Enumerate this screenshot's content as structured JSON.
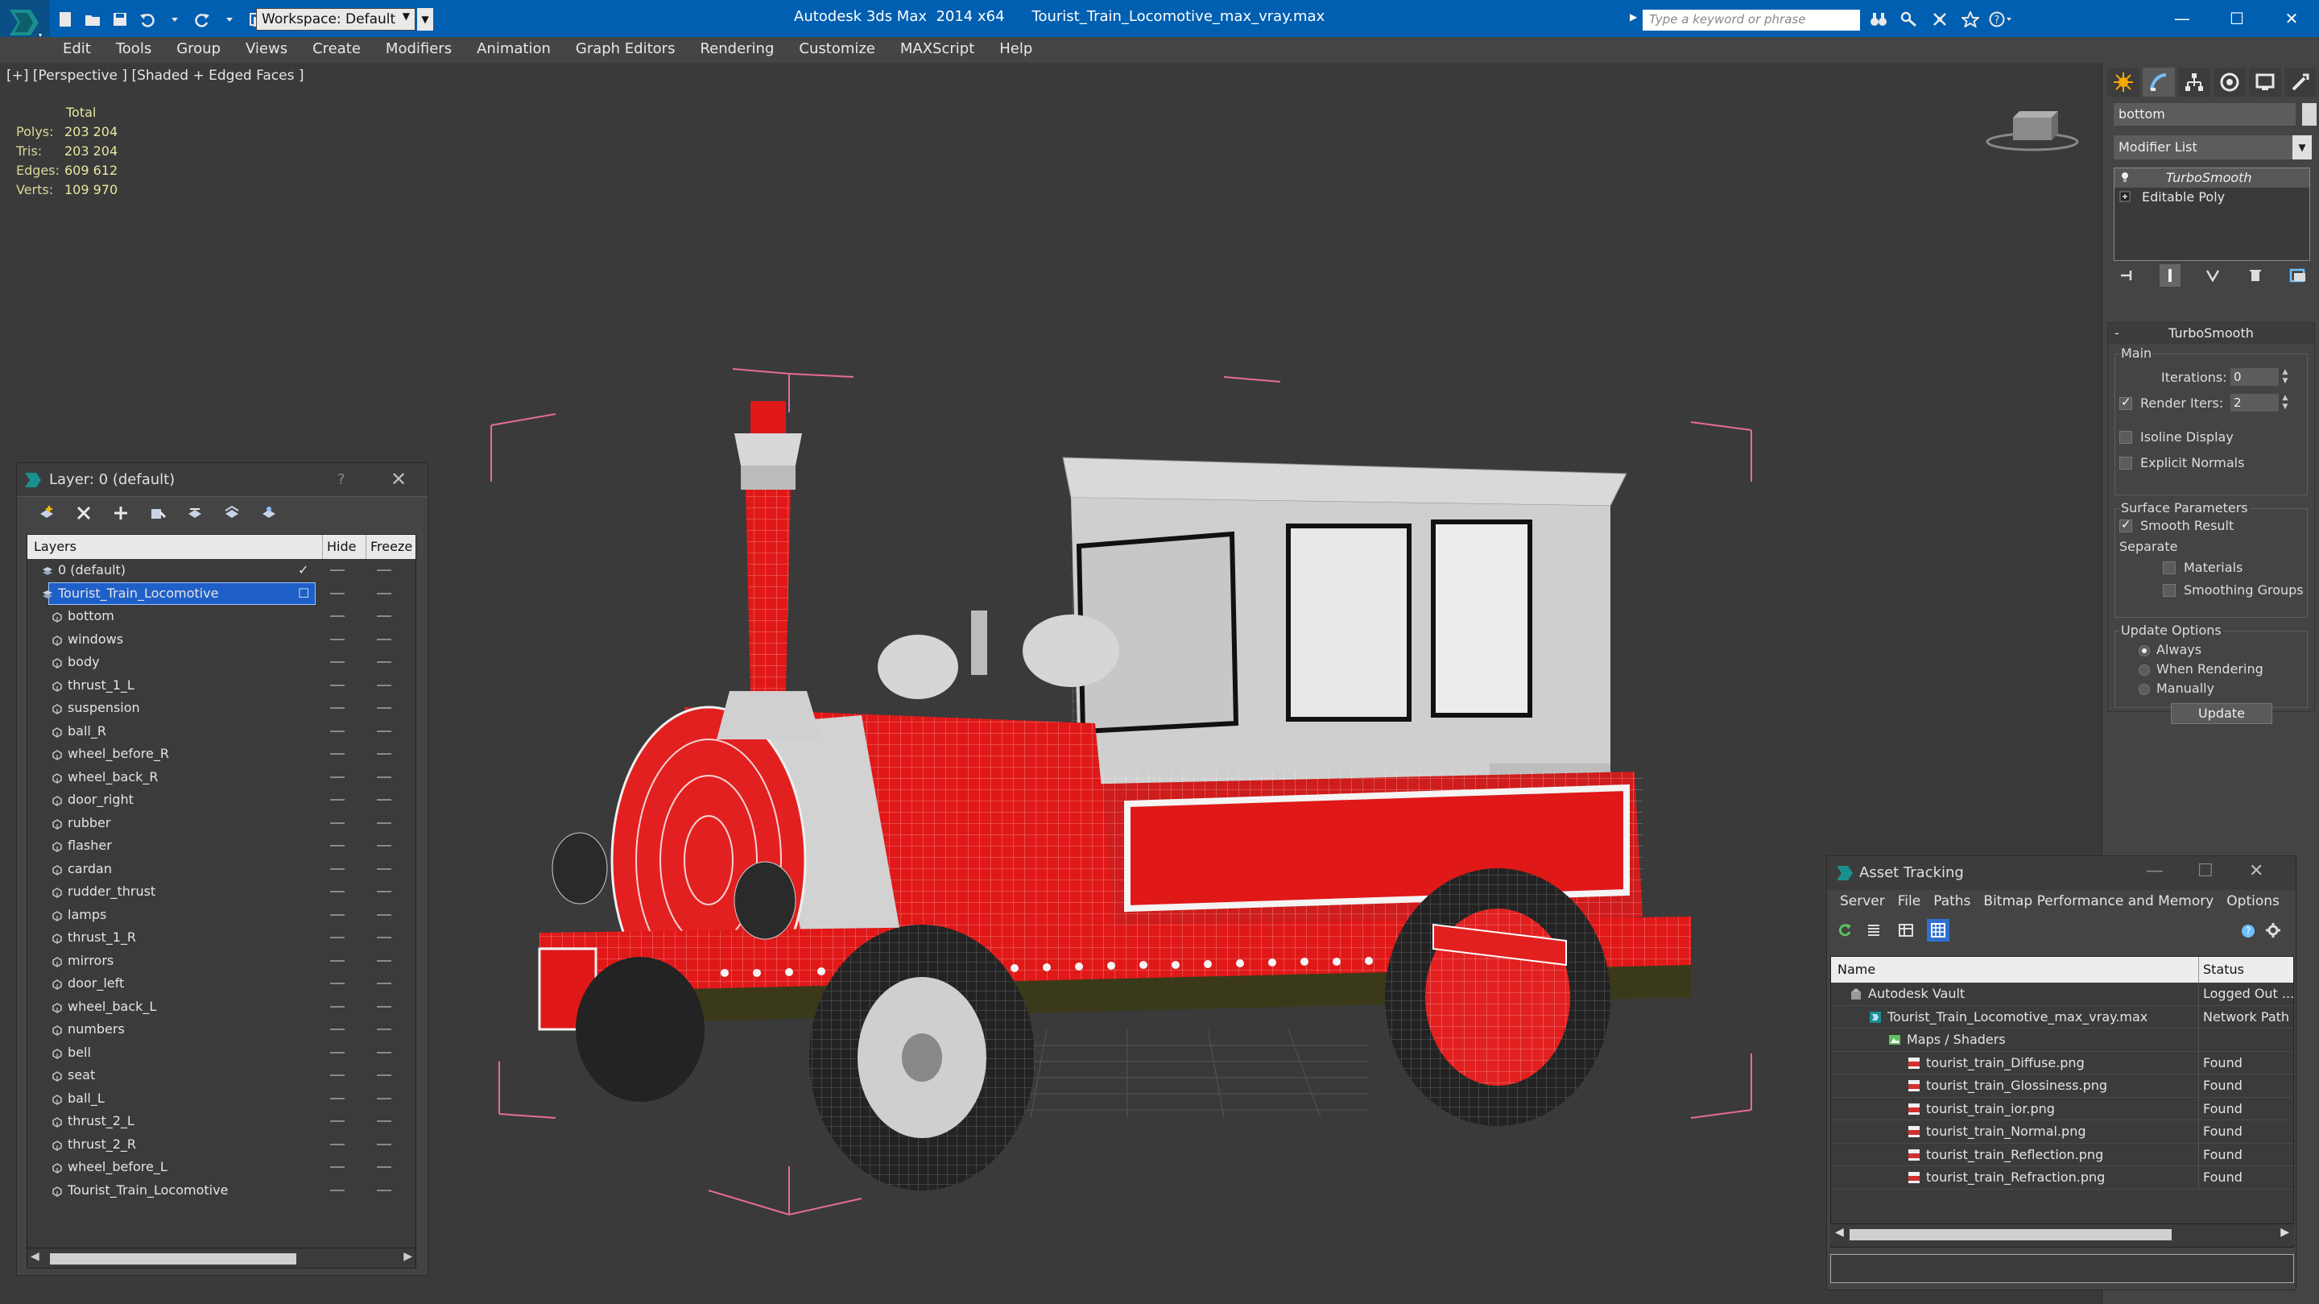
{
  "titlebar": {
    "workspace": "Workspace: Default",
    "app_name": "Autodesk 3ds Max  2014 x64",
    "file_name": "Tourist_Train_Locomotive_max_vray.max",
    "search_placeholder": "Type a keyword or phrase"
  },
  "menu": [
    "Edit",
    "Tools",
    "Group",
    "Views",
    "Create",
    "Modifiers",
    "Animation",
    "Graph Editors",
    "Rendering",
    "Customize",
    "MAXScript",
    "Help"
  ],
  "viewport": {
    "label": "[+] [Perspective ] [Shaded + Edged Faces ]",
    "stats": {
      "header": "Total",
      "rows": [
        {
          "label": "Polys:",
          "value": "203 204"
        },
        {
          "label": "Tris:",
          "value": "203 204"
        },
        {
          "label": "Edges:",
          "value": "609 612"
        },
        {
          "label": "Verts:",
          "value": "109 970"
        }
      ]
    }
  },
  "layer_panel": {
    "title": "Layer: 0 (default)",
    "help": "?",
    "columns": {
      "layers": "Layers",
      "hide": "Hide",
      "freeze": "Freeze"
    },
    "layers": [
      {
        "name": "0 (default)",
        "level": 0,
        "kind": "layer",
        "current": true
      },
      {
        "name": "Tourist_Train_Locomotive",
        "level": 0,
        "kind": "layer",
        "selected": true
      },
      {
        "name": "bottom",
        "level": 1,
        "kind": "object"
      },
      {
        "name": "windows",
        "level": 1,
        "kind": "object"
      },
      {
        "name": "body",
        "level": 1,
        "kind": "object"
      },
      {
        "name": "thrust_1_L",
        "level": 1,
        "kind": "object"
      },
      {
        "name": "suspension",
        "level": 1,
        "kind": "object"
      },
      {
        "name": "ball_R",
        "level": 1,
        "kind": "object"
      },
      {
        "name": "wheel_before_R",
        "level": 1,
        "kind": "object"
      },
      {
        "name": "wheel_back_R",
        "level": 1,
        "kind": "object"
      },
      {
        "name": "door_right",
        "level": 1,
        "kind": "object"
      },
      {
        "name": "rubber",
        "level": 1,
        "kind": "object"
      },
      {
        "name": "flasher",
        "level": 1,
        "kind": "object"
      },
      {
        "name": "cardan",
        "level": 1,
        "kind": "object"
      },
      {
        "name": "rudder_thrust",
        "level": 1,
        "kind": "object"
      },
      {
        "name": "lamps",
        "level": 1,
        "kind": "object"
      },
      {
        "name": "thrust_1_R",
        "level": 1,
        "kind": "object"
      },
      {
        "name": "mirrors",
        "level": 1,
        "kind": "object"
      },
      {
        "name": "door_left",
        "level": 1,
        "kind": "object"
      },
      {
        "name": "wheel_back_L",
        "level": 1,
        "kind": "object"
      },
      {
        "name": "numbers",
        "level": 1,
        "kind": "object"
      },
      {
        "name": "bell",
        "level": 1,
        "kind": "object"
      },
      {
        "name": "seat",
        "level": 1,
        "kind": "object"
      },
      {
        "name": "ball_L",
        "level": 1,
        "kind": "object"
      },
      {
        "name": "thrust_2_L",
        "level": 1,
        "kind": "object"
      },
      {
        "name": "thrust_2_R",
        "level": 1,
        "kind": "object"
      },
      {
        "name": "wheel_before_L",
        "level": 1,
        "kind": "object"
      },
      {
        "name": "Tourist_Train_Locomotive",
        "level": 1,
        "kind": "object"
      }
    ]
  },
  "command_panel": {
    "object_name": "bottom",
    "modifier_list": "Modifier List",
    "stack": [
      {
        "name": "TurboSmooth",
        "selected": true
      },
      {
        "name": "Editable Poly",
        "selected": false
      }
    ],
    "turbosmooth": {
      "title": "TurboSmooth",
      "main_label": "Main",
      "iterations_label": "Iterations:",
      "iterations": "0",
      "render_iters_label": "Render Iters:",
      "render_iters": "2",
      "render_iters_checked": true,
      "isoline_display": "Isoline Display",
      "isoline_checked": false,
      "explicit_normals": "Explicit Normals",
      "explicit_checked": false,
      "surface_label": "Surface Parameters",
      "smooth_result": "Smooth Result",
      "smooth_checked": true,
      "separate_label": "Separate",
      "materials": "Materials",
      "materials_checked": false,
      "smoothing_groups": "Smoothing Groups",
      "smoothing_checked": false,
      "update_label": "Update Options",
      "always": "Always",
      "when_rendering": "When Rendering",
      "manually": "Manually",
      "update_mode": "always",
      "update_button": "Update"
    }
  },
  "asset_panel": {
    "title": "Asset Tracking",
    "menu": [
      "Server",
      "File",
      "Paths",
      "Bitmap Performance and Memory",
      "Options"
    ],
    "columns": {
      "name": "Name",
      "status": "Status"
    },
    "rows": [
      {
        "name": "Autodesk Vault",
        "status": "Logged Out ...",
        "level": 1,
        "icon": "vault"
      },
      {
        "name": "Tourist_Train_Locomotive_max_vray.max",
        "status": "Network Path",
        "level": 2,
        "icon": "max-file"
      },
      {
        "name": "Maps / Shaders",
        "status": "",
        "level": 3,
        "icon": "maps"
      },
      {
        "name": "tourist_train_Diffuse.png",
        "status": "Found",
        "level": 4,
        "icon": "png"
      },
      {
        "name": "tourist_train_Glossiness.png",
        "status": "Found",
        "level": 4,
        "icon": "png"
      },
      {
        "name": "tourist_train_ior.png",
        "status": "Found",
        "level": 4,
        "icon": "png"
      },
      {
        "name": "tourist_train_Normal.png",
        "status": "Found",
        "level": 4,
        "icon": "png"
      },
      {
        "name": "tourist_train_Reflection.png",
        "status": "Found",
        "level": 4,
        "icon": "png"
      },
      {
        "name": "tourist_train_Refraction.png",
        "status": "Found",
        "level": 4,
        "icon": "png"
      }
    ]
  },
  "colors": {
    "titlebar": "#005fb0",
    "selection": "#1f5fc8",
    "train_red": "#e01818",
    "bbox_pink": "#e86a9a"
  }
}
